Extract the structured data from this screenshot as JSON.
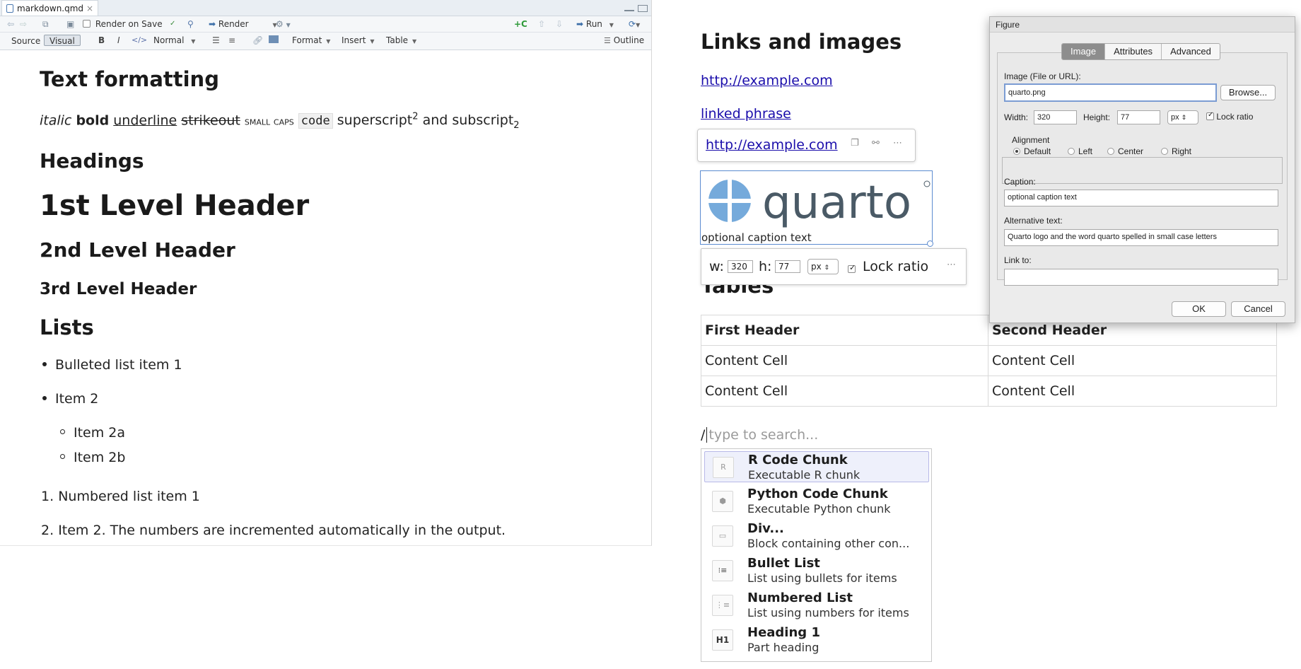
{
  "editor": {
    "tab_title": "markdown.qmd",
    "tab_close": "×",
    "toolbar": {
      "render_on_save": "Render on Save",
      "render": "Render",
      "run": "Run"
    },
    "modebar": {
      "source": "Source",
      "visual": "Visual",
      "bold": "B",
      "italic": "I",
      "code": "</>",
      "style": "Normal",
      "format": "Format",
      "insert": "Insert",
      "table": "Table",
      "outline": "Outline"
    },
    "doc": {
      "text_formatting": "Text formatting",
      "fmt": {
        "italic": "italic",
        "bold": "bold",
        "underline": "underline",
        "strike": "strikeout",
        "smallcaps": "small caps",
        "code": "code",
        "super_base": "superscript",
        "super_mark": "2",
        "and": "and subscript",
        "sub_mark": "2"
      },
      "headings": "Headings",
      "h1": "1st Level Header",
      "h2": "2nd Level Header",
      "h3": "3rd Level Header",
      "lists": "Lists",
      "bullets": [
        "Bulleted list item 1",
        "Item 2"
      ],
      "sub_bullets": [
        "Item 2a",
        "Item 2b"
      ],
      "numbered": [
        {
          "num": "1.",
          "text": "Numbered list item 1"
        },
        {
          "num": "2.",
          "text": "Item 2. The numbers are incremented automatically in the output."
        }
      ]
    }
  },
  "preview": {
    "links_title": "Links and images",
    "link1": "http://example.com",
    "link2": "linked phrase",
    "popover_link": "http://example.com",
    "logo_text": "quarto",
    "caption": "optional caption text",
    "size_popover": {
      "w_label": "w:",
      "w_value": "320",
      "h_label": "h:",
      "h_value": "77",
      "unit": "px",
      "lock": "Lock ratio"
    },
    "tables_title": "Tables",
    "table": {
      "headers": [
        "First Header",
        "Second Header"
      ],
      "rows": [
        [
          "Content Cell",
          "Content Cell"
        ],
        [
          "Content Cell",
          "Content Cell"
        ]
      ]
    },
    "slash": "/",
    "search_placeholder": "type to search...",
    "commands": [
      {
        "title": "R Code Chunk",
        "desc": "Executable R chunk",
        "icon": "R"
      },
      {
        "title": "Python Code Chunk",
        "desc": "Executable Python chunk",
        "icon": "python-icon"
      },
      {
        "title": "Div...",
        "desc": "Block containing other con...",
        "icon": "div-icon"
      },
      {
        "title": "Bullet List",
        "desc": "List using bullets for items",
        "icon": "bullet-list-icon"
      },
      {
        "title": "Numbered List",
        "desc": "List using numbers for items",
        "icon": "numbered-list-icon"
      },
      {
        "title": "Heading 1",
        "desc": "Part heading",
        "icon": "H1"
      }
    ]
  },
  "dialog": {
    "title": "Figure",
    "tabs": [
      "Image",
      "Attributes",
      "Advanced"
    ],
    "image_label": "Image (File or URL):",
    "image_value": "quarto.png",
    "browse": "Browse...",
    "width_label": "Width:",
    "width_value": "320",
    "height_label": "Height:",
    "height_value": "77",
    "unit": "px",
    "lock": "Lock ratio",
    "alignment_label": "Alignment",
    "alignments": [
      "Default",
      "Left",
      "Center",
      "Right"
    ],
    "caption_label": "Caption:",
    "caption_value": "optional caption text",
    "alt_label": "Alternative text:",
    "alt_value": "Quarto logo and the word quarto spelled in small case letters",
    "link_label": "Link to:",
    "link_value": "",
    "ok": "OK",
    "cancel": "Cancel"
  },
  "colors": {
    "link": "#1a0dab",
    "quarto_blue": "#75aadb",
    "quarto_gray": "#4a5a66",
    "selection": "#b8b9e8"
  }
}
